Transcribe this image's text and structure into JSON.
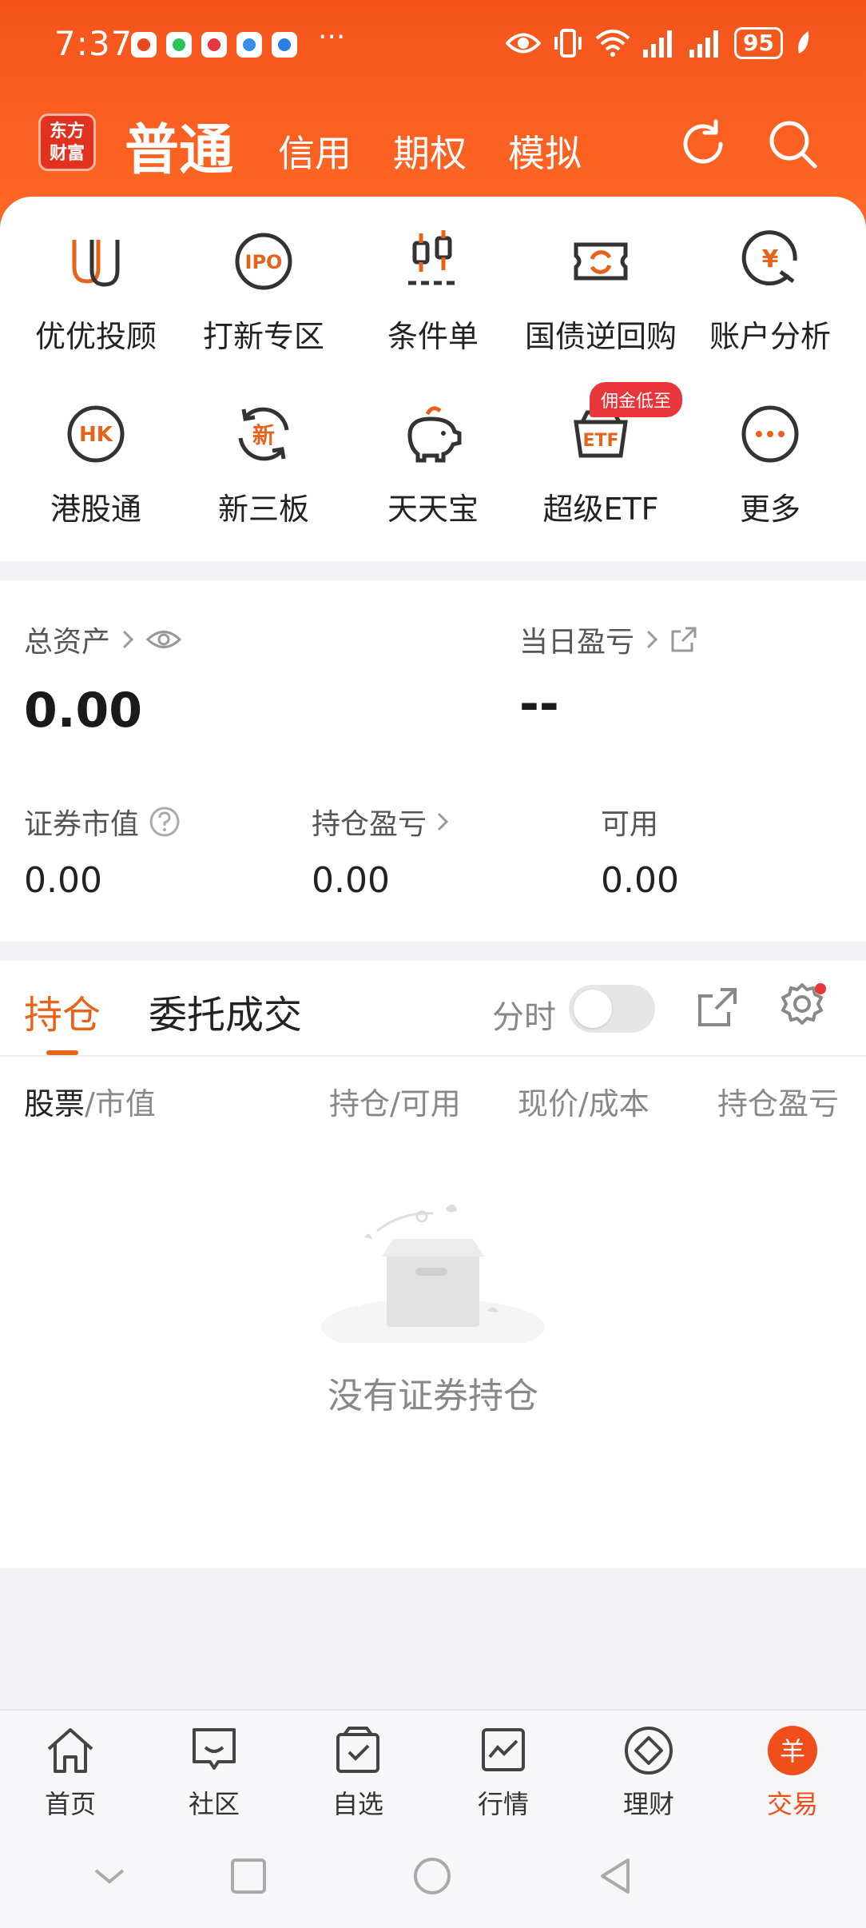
{
  "status_bar": {
    "time": "7:37",
    "more": "···",
    "battery": "95"
  },
  "top_nav": {
    "logo_text": "东方\n财富",
    "tabs": [
      {
        "label": "普通",
        "active": true
      },
      {
        "label": "信用",
        "active": false
      },
      {
        "label": "期权",
        "active": false
      },
      {
        "label": "模拟",
        "active": false
      }
    ]
  },
  "quick_entries": [
    {
      "label": "优优投顾",
      "icon": "uu-advisor-icon"
    },
    {
      "label": "打新专区",
      "icon": "ipo-icon",
      "icon_text": "IPO"
    },
    {
      "label": "条件单",
      "icon": "condition-order-icon"
    },
    {
      "label": "国债逆回购",
      "icon": "repo-icon"
    },
    {
      "label": "账户分析",
      "icon": "account-analysis-icon",
      "icon_text": "¥"
    },
    {
      "label": "港股通",
      "icon": "hk-stock-icon",
      "icon_text": "HK"
    },
    {
      "label": "新三板",
      "icon": "neeq-icon",
      "icon_text": "新"
    },
    {
      "label": "天天宝",
      "icon": "piggy-bank-icon"
    },
    {
      "label": "超级ETF",
      "icon": "etf-icon",
      "icon_text": "ETF",
      "badge": "佣金低至"
    },
    {
      "label": "更多",
      "icon": "more-icon"
    }
  ],
  "assets": {
    "total_label": "总资产",
    "total_value": "0.00",
    "day_pl_label": "当日盈亏",
    "day_pl_value": "--",
    "market_value_label": "证券市值",
    "market_value": "0.00",
    "position_pl_label": "持仓盈亏",
    "position_pl": "0.00",
    "available_label": "可用",
    "available": "0.00"
  },
  "positions": {
    "tab_holdings": "持仓",
    "tab_orders": "委托成交",
    "fenshi_label": "分时",
    "fenshi_on": false,
    "columns": {
      "stock": "股票",
      "stock_sub": "/市值",
      "qty": "持仓/可用",
      "price": "现价/成本",
      "pl": "持仓盈亏"
    },
    "empty_text": "没有证券持仓"
  },
  "tab_bar": [
    {
      "label": "首页",
      "icon": "home-icon"
    },
    {
      "label": "社区",
      "icon": "community-icon"
    },
    {
      "label": "自选",
      "icon": "watchlist-icon"
    },
    {
      "label": "行情",
      "icon": "market-icon"
    },
    {
      "label": "理财",
      "icon": "wealth-icon"
    },
    {
      "label": "交易",
      "icon": "trade-icon",
      "active": true,
      "icon_text": "羊"
    }
  ],
  "colors": {
    "brand": "#f4541c",
    "accent": "#e8631a",
    "badge": "#e8363a"
  }
}
